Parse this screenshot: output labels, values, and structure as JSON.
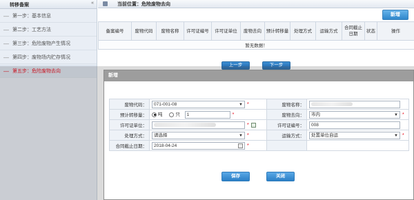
{
  "sidebar": {
    "title": "转移备案",
    "collapse_glyph": "«",
    "items": [
      {
        "label": "第一步：基本信息"
      },
      {
        "label": "第二步：工艺方法"
      },
      {
        "label": "第三步：危险废物产生情况"
      },
      {
        "label": "第四步：废物场内贮存情况"
      },
      {
        "label": "第五步：危险废物去向"
      }
    ],
    "active_index": 4
  },
  "header": {
    "location": "当前位置：危险废物去向",
    "new_button": "新增"
  },
  "grid": {
    "columns": [
      "备案编号",
      "废物代码",
      "废物名称",
      "许可证编号",
      "许可证单位",
      "废物去向",
      "预计转移量",
      "处理方式",
      "运输方式",
      "合同截止日期",
      "状态",
      "操作"
    ],
    "empty_text": "暂无数据！"
  },
  "pager": {
    "prev": "上一步",
    "next": "下一步"
  },
  "dialog": {
    "title": "新增",
    "fields": {
      "waste_code_label": "废物代码：",
      "waste_code_value": "071-001-08",
      "waste_name_label": "废物名称：",
      "estimated_label": "预计转移量：",
      "unit_ton": "吨",
      "unit_piece": "只",
      "estimated_value": "1",
      "destination_label": "废物去向：",
      "destination_value": "市内",
      "license_unit_label": "许可证单位：",
      "license_no_label": "许可证编号：",
      "license_no_value": "008",
      "process_label": "处理方式：",
      "process_value": "请选择",
      "transport_label": "运输方式：",
      "transport_value": "处置单位自运",
      "contract_label": "合同截止日期：",
      "contract_value": "2018-04-24",
      "required_mark": "*"
    },
    "save": "保存",
    "close": "关闭"
  },
  "colors": {
    "accent_blue": "#2f86cb",
    "active_red": "#e60012",
    "dialog_title": "#9d9d9d"
  }
}
